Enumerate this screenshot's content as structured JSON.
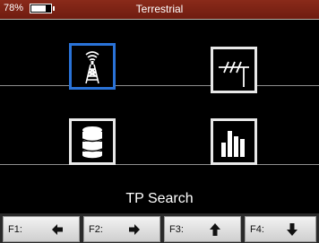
{
  "status": {
    "battery_percent": "78%",
    "battery_level": 0.78,
    "title": "Terrestrial"
  },
  "menu": {
    "items": [
      {
        "name": "antenna-tower",
        "icon": "antenna-tower-icon",
        "selected": true
      },
      {
        "name": "antenna",
        "icon": "antenna-icon",
        "selected": false
      },
      {
        "name": "database",
        "icon": "database-icon",
        "selected": false
      },
      {
        "name": "bar-graph",
        "icon": "bar-chart-icon",
        "selected": false
      }
    ],
    "selected_label": "TP Search"
  },
  "fkeys": [
    {
      "label": "F1:",
      "icon": "arrow-left-icon"
    },
    {
      "label": "F2:",
      "icon": "arrow-right-icon"
    },
    {
      "label": "F3:",
      "icon": "arrow-up-icon"
    },
    {
      "label": "F4:",
      "icon": "arrow-down-icon"
    }
  ],
  "colors": {
    "status_bar": "#7a2414",
    "selection": "#2a73d8",
    "background": "#000000"
  }
}
